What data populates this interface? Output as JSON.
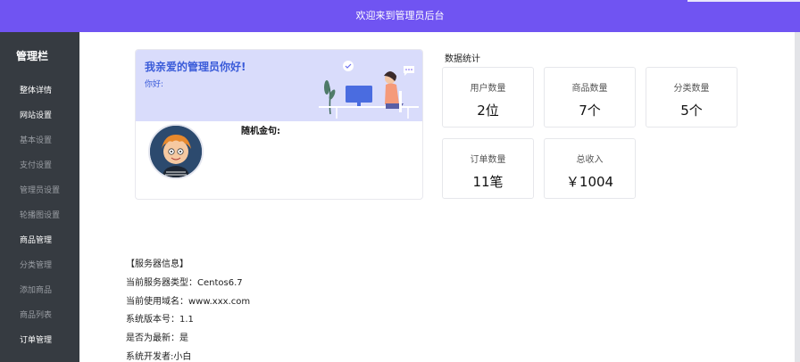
{
  "header": {
    "title": "欢迎来到管理员后台"
  },
  "sidebar": {
    "title": "管理栏",
    "items": [
      {
        "label": "整体详情",
        "group": true
      },
      {
        "label": "网站设置",
        "group": true
      },
      {
        "label": "基本设置",
        "group": false
      },
      {
        "label": "支付设置",
        "group": false
      },
      {
        "label": "管理员设置",
        "group": false
      },
      {
        "label": "轮播图设置",
        "group": false
      },
      {
        "label": "商品管理",
        "group": true
      },
      {
        "label": "分类管理",
        "group": false
      },
      {
        "label": "添加商品",
        "group": false
      },
      {
        "label": "商品列表",
        "group": false
      },
      {
        "label": "订单管理",
        "group": true
      }
    ]
  },
  "welcome": {
    "title": "我亲爱的管理员你好!",
    "greeting": "你好:",
    "quote_label": "随机金句:"
  },
  "stats": {
    "title": "数据统计",
    "cards": [
      {
        "label": "用户数量",
        "value": "2位"
      },
      {
        "label": "商品数量",
        "value": "7个"
      },
      {
        "label": "分类数量",
        "value": "5个"
      },
      {
        "label": "订单数量",
        "value": "11笔"
      },
      {
        "label": "总收入",
        "value": "￥1004"
      }
    ]
  },
  "server": {
    "heading": "【服务器信息】",
    "lines": [
      "当前服务器类型：Centos6.7",
      "当前使用域名：www.xxx.com",
      "系统版本号：1.1",
      "是否为最新：是",
      "系统开发者:小白"
    ]
  },
  "colors": {
    "header": "#7054f2",
    "sidebar": "#363b41",
    "welcome_banner": "#d9dcfb",
    "accent_text": "#3a5bd9"
  }
}
